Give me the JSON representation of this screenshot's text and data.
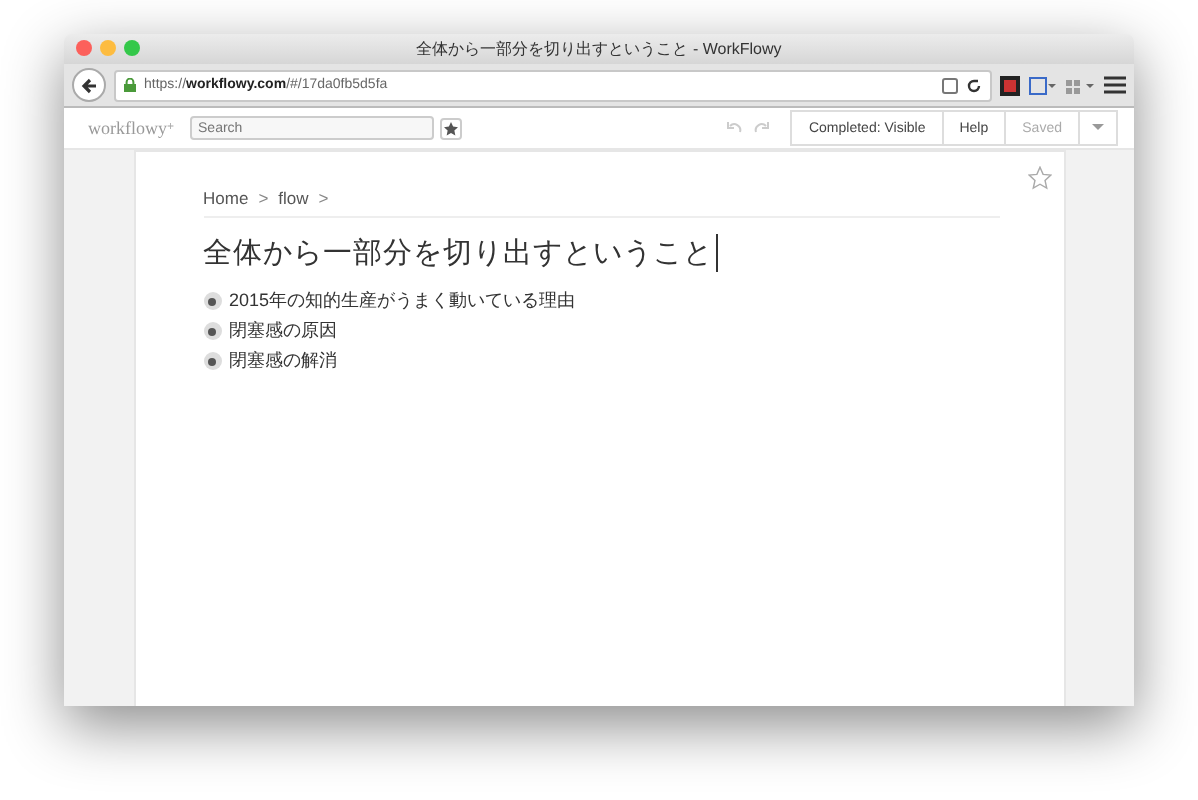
{
  "window": {
    "title": "全体から一部分を切り出すということ - WorkFlowy"
  },
  "browser": {
    "url": "https://**workflowy.com**/#/17da0fb5d5fa"
  },
  "app_bar": {
    "logo": "workflowy",
    "logo_plus": "+",
    "search": {
      "placeholder": "Search"
    },
    "buttons": [
      {
        "label": "Completed: Visible",
        "disabled": false
      },
      {
        "label": "Help",
        "disabled": false
      },
      {
        "label": "Saved",
        "disabled": true
      }
    ]
  },
  "breadcrumb": [
    {
      "label": "Home",
      "separator": ">"
    },
    {
      "label": "flow",
      "separator": ">"
    }
  ],
  "page_title": "全体から一部分を切り出すということ",
  "items": [
    {
      "text": "2015年の知的生産がうまく動いている理由"
    },
    {
      "text": "閉塞感の原因"
    },
    {
      "text": "閉塞感の解消"
    }
  ]
}
